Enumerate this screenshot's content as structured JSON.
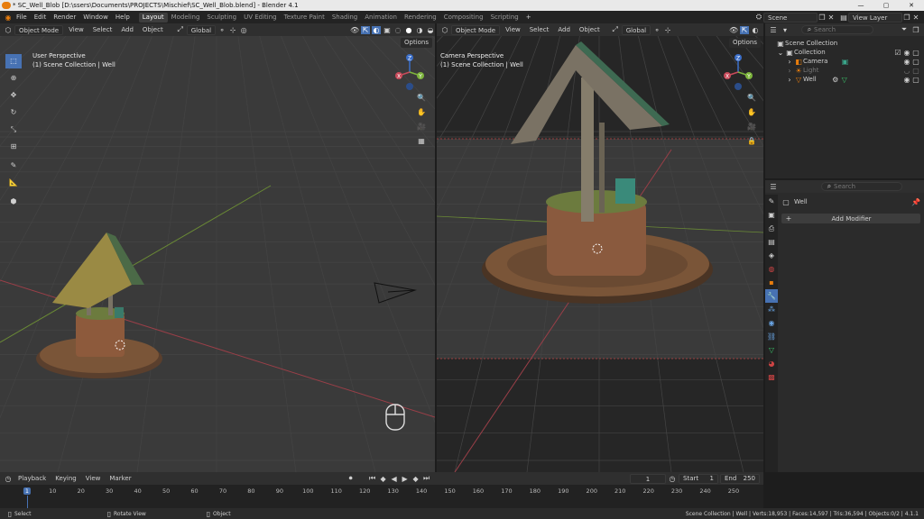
{
  "window": {
    "title": "* SC_Well_Blob [D:\\ssers\\Documents\\PROJECTS\\Mischief\\SC_Well_Blob.blend] - Blender 4.1",
    "minimize": "—",
    "maximize": "▢",
    "close": "✕"
  },
  "menu": [
    "File",
    "Edit",
    "Render",
    "Window",
    "Help"
  ],
  "workspaces": [
    "Layout",
    "Modeling",
    "Sculpting",
    "UV Editing",
    "Texture Paint",
    "Shading",
    "Animation",
    "Rendering",
    "Compositing",
    "Scripting"
  ],
  "workspace_add": "+",
  "scene": {
    "label": "Scene",
    "view_layer": "View Layer"
  },
  "viewport_header": {
    "mode": "Object Mode",
    "menus": [
      "View",
      "Select",
      "Add",
      "Object"
    ],
    "transform": "Global",
    "options": "Options"
  },
  "left_viewport": {
    "title": "User Perspective",
    "subtitle": "(1) Scene Collection | Well"
  },
  "right_viewport": {
    "title": "Camera Perspective",
    "subtitle": "(1) Scene Collection | Well"
  },
  "gizmo": {
    "x": "X",
    "y": "Y",
    "z": "Z"
  },
  "outliner": {
    "search_placeholder": "Search",
    "items": [
      {
        "label": "Scene Collection"
      },
      {
        "label": "Collection"
      },
      {
        "label": "Camera"
      },
      {
        "label": "Light"
      },
      {
        "label": "Well"
      }
    ]
  },
  "properties": {
    "search_placeholder": "Search",
    "object_name": "Well",
    "add_modifier": "Add Modifier"
  },
  "timeline": {
    "menus": [
      "Playback",
      "Keying",
      "View",
      "Marker"
    ],
    "current_frame": "1",
    "start_label": "Start",
    "start": "1",
    "end_label": "End",
    "end": "250",
    "ticks": [
      "1",
      "10",
      "20",
      "30",
      "40",
      "50",
      "60",
      "70",
      "80",
      "90",
      "100",
      "110",
      "120",
      "130",
      "140",
      "150",
      "160",
      "170",
      "180",
      "190",
      "200",
      "210",
      "220",
      "230",
      "240",
      "250"
    ]
  },
  "statusbar": {
    "select": "Select",
    "rotate": "Rotate View",
    "object": "Object",
    "info": "Scene Collection | Well | Verts:18,953 | Faces:14,597 | Tris:36,594 | Objects:0/2 | 4.1.1"
  },
  "colors": {
    "accent": "#4772b3",
    "bg": "#1d1d1d",
    "header": "#303030",
    "viewport": "#393939"
  }
}
